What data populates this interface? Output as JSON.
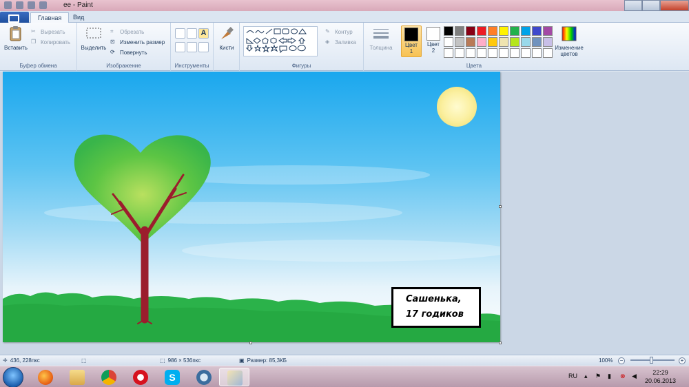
{
  "window": {
    "title": "ее - Paint"
  },
  "tabs": {
    "home": "Главная",
    "view": "Вид"
  },
  "clipboard": {
    "paste": "Вставить",
    "cut": "Вырезать",
    "copy": "Копировать",
    "label": "Буфер обмена"
  },
  "image": {
    "select": "Выделить",
    "crop": "Обрезать",
    "resize": "Изменить размер",
    "rotate": "Повернуть",
    "label": "Изображение"
  },
  "tools": {
    "label": "Инструменты",
    "brushes": "Кисти"
  },
  "shapes": {
    "label": "Фигуры",
    "outline": "Контур",
    "fill": "Заливка",
    "size": "Толщина"
  },
  "colors": {
    "color1": "Цвет",
    "color1_num": "1",
    "color2": "Цвет",
    "color2_num": "2",
    "label": "Цвета",
    "edit": "Изменение цветов",
    "color1_value": "#000000",
    "color2_value": "#ffffff",
    "palette_row1": [
      "#000000",
      "#7f7f7f",
      "#880015",
      "#ed1c24",
      "#ff7f27",
      "#fff200",
      "#22b14c",
      "#00a2e8",
      "#3f48cc",
      "#a349a4"
    ],
    "palette_row2": [
      "#ffffff",
      "#c3c3c3",
      "#b97a57",
      "#ffaec9",
      "#ffc90e",
      "#efe4b0",
      "#b5e61d",
      "#99d9ea",
      "#7092be",
      "#c8bfe7"
    ],
    "palette_row3": [
      "#ffffff",
      "#ffffff",
      "#ffffff",
      "#ffffff",
      "#ffffff",
      "#ffffff",
      "#ffffff",
      "#ffffff",
      "#ffffff",
      "#ffffff"
    ]
  },
  "canvas": {
    "caption_line1": "Сашенька,",
    "caption_line2": "17 годиков"
  },
  "statusbar": {
    "cursor": "436, 228пкс",
    "size": "986 × 536пкс",
    "filesize": "Размер: 85,3КБ",
    "zoom": "100%"
  },
  "taskbar": {
    "lang": "RU",
    "time": "22:29",
    "date": "20.06.2013"
  }
}
